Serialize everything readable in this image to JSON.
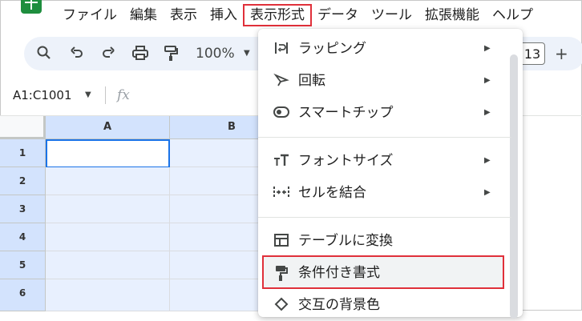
{
  "menubar": {
    "items": [
      "ファイル",
      "編集",
      "表示",
      "挿入",
      "表示形式",
      "データ",
      "ツール",
      "拡張機能",
      "ヘルプ"
    ],
    "highlighted_index": 4
  },
  "toolbar": {
    "icons": [
      "search-icon",
      "undo-icon",
      "redo-icon",
      "print-icon",
      "paint-format-icon"
    ],
    "zoom": "100%",
    "font_size": "13",
    "plus": "+"
  },
  "formula_bar": {
    "name_box": "A1:C1001",
    "fx": "fx"
  },
  "grid": {
    "columns": [
      "A",
      "B"
    ],
    "rows": [
      "1",
      "2",
      "3",
      "4",
      "5",
      "6"
    ]
  },
  "format_menu": {
    "groups": [
      [
        {
          "label": "ラッピング",
          "icon": "wrap-icon",
          "has_submenu": true
        },
        {
          "label": "回転",
          "icon": "rotate-icon",
          "has_submenu": true
        },
        {
          "label": "スマートチップ",
          "icon": "smart-chip-icon",
          "has_submenu": true
        }
      ],
      [
        {
          "label": "フォントサイズ",
          "icon": "font-size-icon",
          "has_submenu": true
        },
        {
          "label": "セルを結合",
          "icon": "merge-cells-icon",
          "has_submenu": true
        }
      ],
      [
        {
          "label": "テーブルに変換",
          "icon": "table-icon",
          "has_submenu": false
        },
        {
          "label": "条件付き書式",
          "icon": "paint-roller-icon",
          "has_submenu": false,
          "highlighted": true
        },
        {
          "label": "交互の背景色",
          "icon": "alternating-colors-icon",
          "has_submenu": false
        }
      ]
    ]
  },
  "colors": {
    "accent_red": "#e0303a",
    "selection_blue": "#1a73e8",
    "header_selected": "#d3e3fd",
    "cell_selected": "#e8f0fe"
  }
}
